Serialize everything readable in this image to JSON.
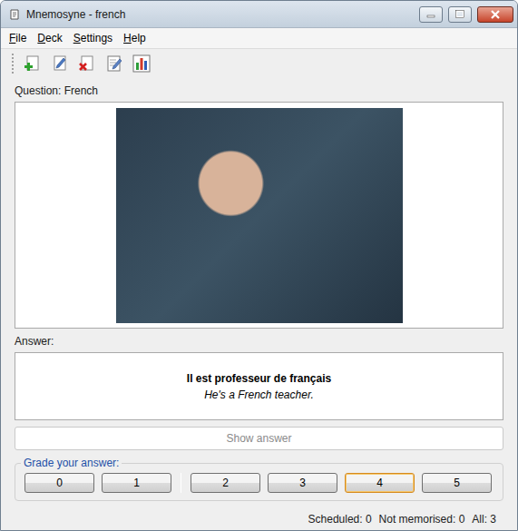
{
  "window": {
    "title": "Mnemosyne - french"
  },
  "menu": [
    {
      "label": "File"
    },
    {
      "label": "Deck"
    },
    {
      "label": "Settings"
    },
    {
      "label": "Help"
    }
  ],
  "question": {
    "label": "Question: French"
  },
  "answer": {
    "label": "Answer:",
    "text": "Il est professeur de français",
    "translation": "He's a French teacher."
  },
  "show_answer": {
    "label": "Show answer",
    "disabled": true
  },
  "grading": {
    "label": "Grade your answer:",
    "groups": [
      [
        {
          "label": "0",
          "selected": false
        },
        {
          "label": "1",
          "selected": false
        }
      ],
      [
        {
          "label": "2",
          "selected": false
        },
        {
          "label": "3",
          "selected": false
        },
        {
          "label": "4",
          "selected": true
        },
        {
          "label": "5",
          "selected": false
        }
      ]
    ]
  },
  "status_bar": [
    "Scheduled: 0",
    "Not memorised: 0",
    "All: 3"
  ]
}
